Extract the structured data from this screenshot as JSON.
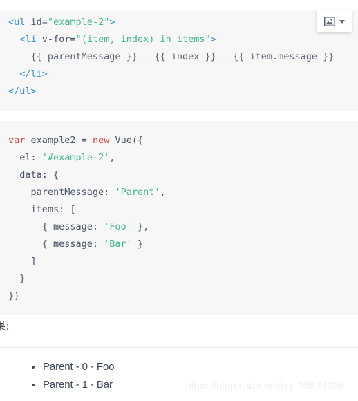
{
  "code_block_1": {
    "language": "html",
    "lines": [
      [
        {
          "t": "<ul",
          "c": "tag"
        },
        {
          "t": " ",
          "c": "plain"
        },
        {
          "t": "id=",
          "c": "attr"
        },
        {
          "t": "\"example-2\"",
          "c": "string"
        },
        {
          "t": ">",
          "c": "tag"
        }
      ],
      [
        {
          "t": "  ",
          "c": "plain"
        },
        {
          "t": "<li",
          "c": "tag"
        },
        {
          "t": " ",
          "c": "plain"
        },
        {
          "t": "v-for=",
          "c": "attr"
        },
        {
          "t": "\"(item, index) in items\"",
          "c": "string"
        },
        {
          "t": ">",
          "c": "tag"
        }
      ],
      [
        {
          "t": "    {{ parentMessage }} - {{ index }} - {{ item.message }}",
          "c": "plain"
        }
      ],
      [
        {
          "t": "  ",
          "c": "plain"
        },
        {
          "t": "</li>",
          "c": "tag"
        }
      ],
      [
        {
          "t": "</ul>",
          "c": "tag"
        }
      ]
    ]
  },
  "code_block_2": {
    "language": "javascript",
    "lines": [
      [
        {
          "t": "var",
          "c": "keyword"
        },
        {
          "t": " example2 = ",
          "c": "punct"
        },
        {
          "t": "new",
          "c": "keyword"
        },
        {
          "t": " Vue({",
          "c": "punct"
        }
      ],
      [
        {
          "t": "  el: ",
          "c": "punct"
        },
        {
          "t": "'#example-2'",
          "c": "string"
        },
        {
          "t": ",",
          "c": "punct"
        }
      ],
      [
        {
          "t": "  data: {",
          "c": "punct"
        }
      ],
      [
        {
          "t": "    parentMessage: ",
          "c": "punct"
        },
        {
          "t": "'Parent'",
          "c": "string"
        },
        {
          "t": ",",
          "c": "punct"
        }
      ],
      [
        {
          "t": "    items: [",
          "c": "punct"
        }
      ],
      [
        {
          "t": "      { message: ",
          "c": "punct"
        },
        {
          "t": "'Foo'",
          "c": "string"
        },
        {
          "t": " },",
          "c": "punct"
        }
      ],
      [
        {
          "t": "      { message: ",
          "c": "punct"
        },
        {
          "t": "'Bar'",
          "c": "string"
        },
        {
          "t": " }",
          "c": "punct"
        }
      ],
      [
        {
          "t": "    ]",
          "c": "punct"
        }
      ],
      [
        {
          "t": "  }",
          "c": "punct"
        }
      ],
      [
        {
          "t": "})",
          "c": "punct"
        }
      ]
    ]
  },
  "image_tool": {
    "icon_name": "image-icon",
    "caret_name": "chevron-down-icon"
  },
  "result": {
    "heading": "果:",
    "items": [
      "Parent - 0 - Foo",
      "Parent - 1 - Bar"
    ]
  },
  "watermark": {
    "text": "https://blog.csdn.net/qq_36524086"
  },
  "colors": {
    "code_background": "#f7f7f8",
    "tag": "#3b8fd6",
    "string": "#3fb984",
    "keyword": "#e03b36",
    "text": "#4b5563",
    "divider": "#e8e8ea",
    "list_text": "#3d4759",
    "watermark": "#f0f0f0"
  }
}
